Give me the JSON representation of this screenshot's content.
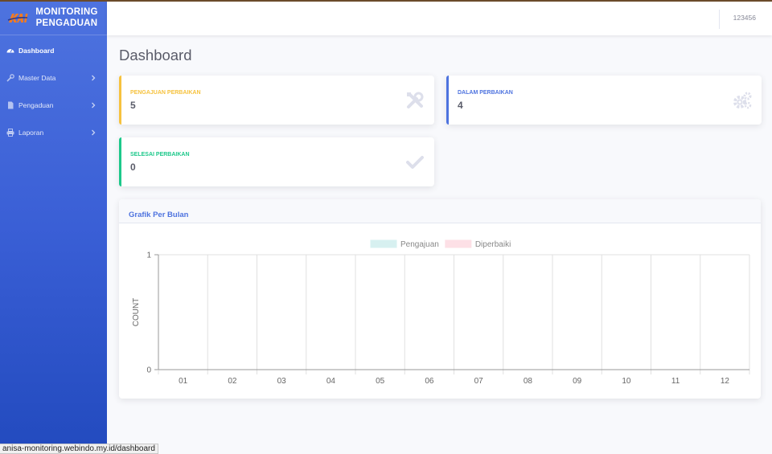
{
  "app": {
    "brand_line1": "MONITORING",
    "brand_line2": "PENGADUAN"
  },
  "sidebar": {
    "items": [
      {
        "label": "Dashboard",
        "icon": "tachometer-icon",
        "active": true
      },
      {
        "label": "Master Data",
        "icon": "wrench-icon",
        "active": false
      },
      {
        "label": "Pengaduan",
        "icon": "file-icon",
        "active": false
      },
      {
        "label": "Laporan",
        "icon": "print-icon",
        "active": false
      }
    ]
  },
  "topbar": {
    "user": "123456"
  },
  "page": {
    "title": "Dashboard"
  },
  "cards": [
    {
      "label": "PENGAJUAN PERBAIKAN",
      "value": "5",
      "color": "#f6c23e",
      "icon": "tools-icon"
    },
    {
      "label": "DALAM PERBAIKAN",
      "value": "4",
      "color": "#4e73df",
      "icon": "cogs-icon"
    },
    {
      "label": "SELESAI PERBAIKAN",
      "value": "0",
      "color": "#1cc88a",
      "icon": "check-icon"
    }
  ],
  "chart_panel": {
    "title": "Grafik Per Bulan"
  },
  "chart_data": {
    "type": "bar",
    "categories": [
      "01",
      "02",
      "03",
      "04",
      "05",
      "06",
      "07",
      "08",
      "09",
      "10",
      "11",
      "12"
    ],
    "series": [
      {
        "name": "Pengajuan",
        "values": [
          0,
          0,
          0,
          0,
          0,
          0,
          0,
          0,
          0,
          0,
          0,
          0
        ],
        "color": "#d7f0f0"
      },
      {
        "name": "Diperbaiki",
        "values": [
          0,
          0,
          0,
          0,
          0,
          0,
          0,
          0,
          0,
          0,
          0,
          0
        ],
        "color": "#fde0e6"
      }
    ],
    "ylabel": "COUNT",
    "ylim": [
      0,
      1
    ],
    "yticks": [
      "0",
      "1"
    ],
    "legend": "top-center",
    "grid": true
  },
  "statusbar": {
    "url": "anisa-monitoring.webindo.my.id/dashboard"
  }
}
